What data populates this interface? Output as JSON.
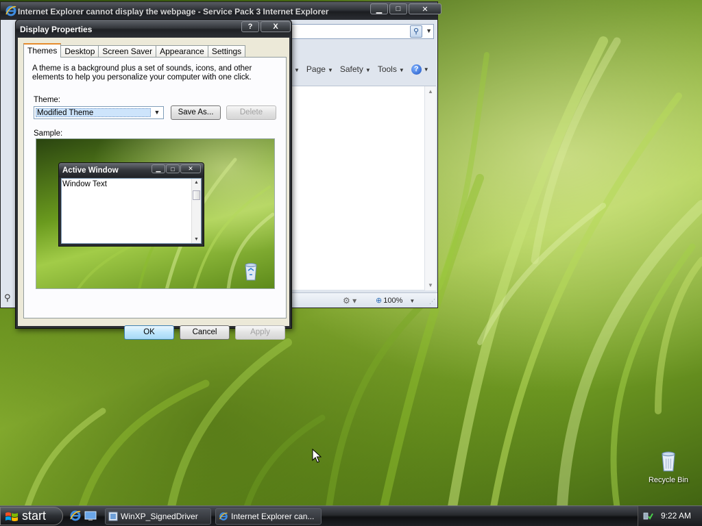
{
  "ie": {
    "title": "Internet Explorer cannot display the webpage - Service Pack 3 Internet Explorer",
    "cmd_page": "Page",
    "cmd_safety": "Safety",
    "cmd_tools": "Tools",
    "help_glyph": "?",
    "zoom": "100%"
  },
  "dialog": {
    "title": "Display Properties",
    "help_glyph": "?",
    "close_glyph": "X",
    "tabs": [
      "Themes",
      "Desktop",
      "Screen Saver",
      "Appearance",
      "Settings"
    ],
    "description": "A theme is a background plus a set of sounds, icons, and other elements to help you personalize your computer with one click.",
    "theme_label": "Theme:",
    "theme_value": "Modified Theme",
    "save_as": "Save As...",
    "delete": "Delete",
    "sample_label": "Sample:",
    "preview": {
      "window_title": "Active Window",
      "window_text": "Window Text"
    },
    "ok": "OK",
    "cancel": "Cancel",
    "apply": "Apply"
  },
  "desktop": {
    "recycle_bin": "Recycle Bin"
  },
  "taskbar": {
    "start": "start",
    "tasks": [
      "WinXP_SignedDriver",
      "Internet Explorer can..."
    ],
    "clock": "9:22 AM"
  },
  "colors": {
    "tab_highlight": "#e68b2c",
    "selection": "#cde4fb",
    "dialog_face": "#ece9d8"
  }
}
